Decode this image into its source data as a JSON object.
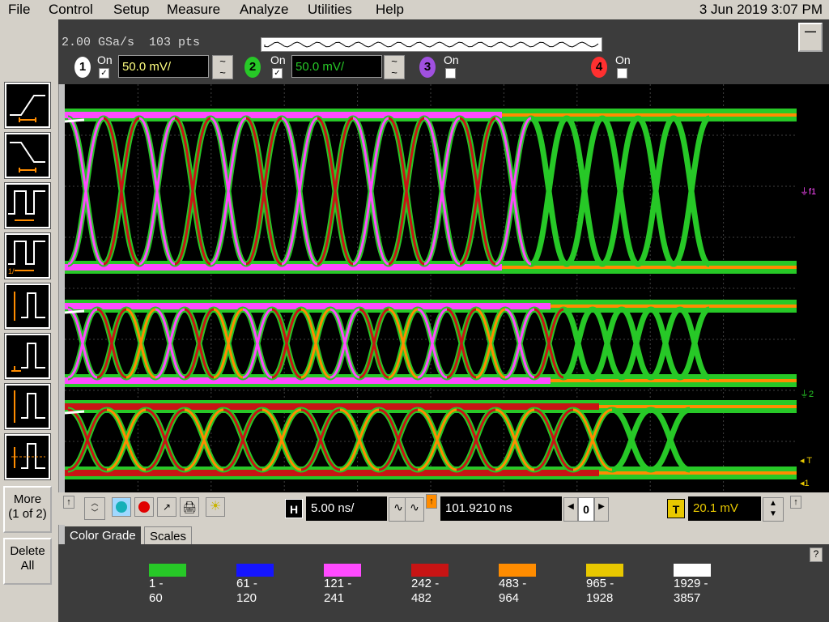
{
  "menu": {
    "items": [
      "File",
      "Control",
      "Setup",
      "Measure",
      "Analyze",
      "Utilities",
      "Help"
    ],
    "datetime": "3 Jun 2019  3:07 PM"
  },
  "acquisition": {
    "sample_rate": "2.00 GSa/s",
    "points": "103 pts"
  },
  "minimize_label": "—",
  "channels": [
    {
      "num": "1",
      "on_label": "On",
      "checked": true,
      "scale": "50.0 mV/",
      "color": "#ffffff"
    },
    {
      "num": "2",
      "on_label": "On",
      "checked": true,
      "scale": "50.0 mV/",
      "color": "#27c827"
    },
    {
      "num": "3",
      "on_label": "On",
      "checked": false,
      "color": "#a050e0"
    },
    {
      "num": "4",
      "on_label": "On",
      "checked": false,
      "color": "#ff3030"
    }
  ],
  "side": {
    "more_label": "More",
    "more_sub": "(1 of 2)",
    "delete_label": "Delete",
    "delete_sub": "All"
  },
  "timebase": {
    "h_label": "H",
    "scale": "5.00 ns/",
    "delay": "101.9210 ns",
    "ref": "0",
    "trigger_label": "T",
    "trigger_level": "20.1 mV"
  },
  "markers": {
    "f1": "f1",
    "ch2": "2",
    "trigger": "T",
    "ch1": "1"
  },
  "tabs": [
    "Color Grade",
    "Scales"
  ],
  "help_label": "?",
  "legend": [
    {
      "color": "#27c827",
      "range": "1 -",
      "range2": "60"
    },
    {
      "color": "#1515ff",
      "range": "61 -",
      "range2": "120"
    },
    {
      "color": "#ff4aff",
      "range": "121 -",
      "range2": "241"
    },
    {
      "color": "#c81414",
      "range": "242 -",
      "range2": "482"
    },
    {
      "color": "#ff8c00",
      "range": "483 -",
      "range2": "964"
    },
    {
      "color": "#e8c800",
      "range": "965 -",
      "range2": "1928"
    },
    {
      "color": "#ffffff",
      "range": "1929 -",
      "range2": "3857"
    }
  ]
}
